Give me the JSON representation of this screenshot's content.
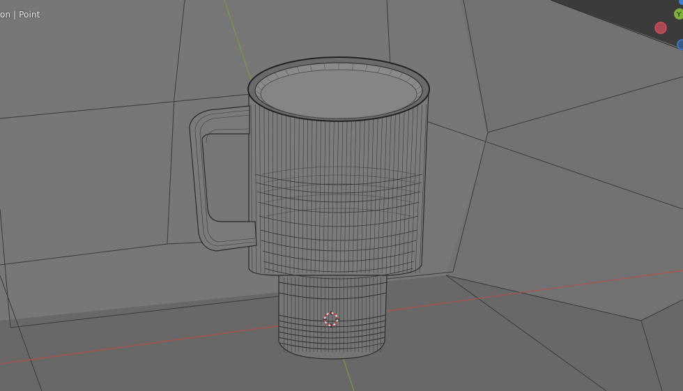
{
  "viewport": {
    "overlay_text": "on | Point"
  },
  "gizmo": {
    "y_label": "Y",
    "colors": {
      "x": "#d94c5a",
      "y": "#7fb03a",
      "z": "#3e7fd6"
    }
  },
  "axis_colors": {
    "x_line": "#c0504d",
    "y_line": "#7a9a3c"
  },
  "background_colors": {
    "wall": "#767676",
    "floor": "#6a6a6a"
  }
}
